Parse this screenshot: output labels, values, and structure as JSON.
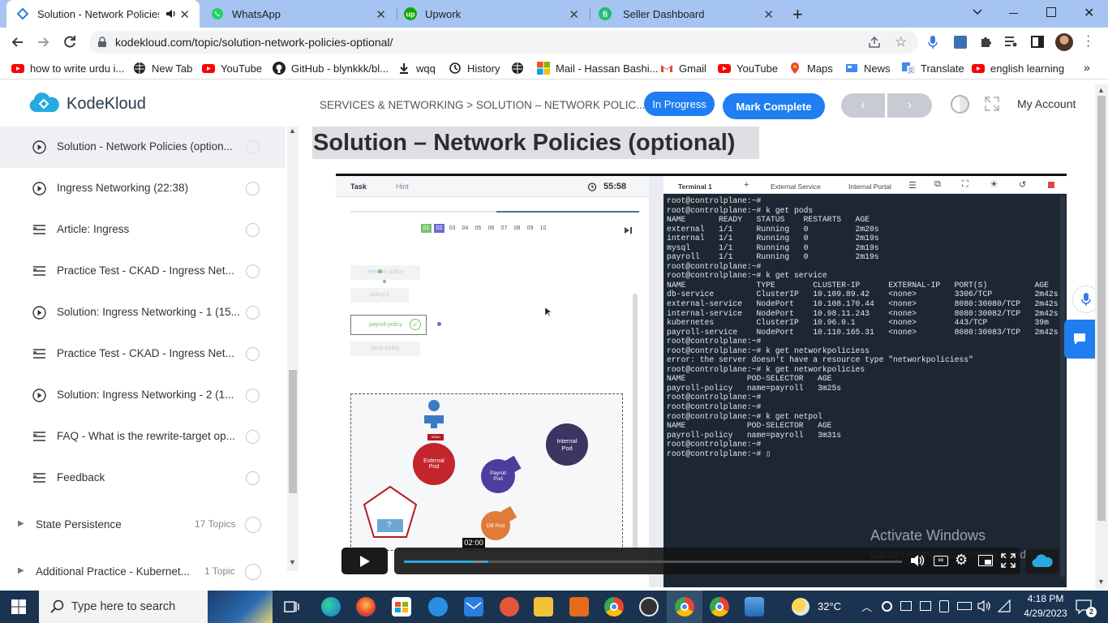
{
  "browser": {
    "tabs": [
      {
        "title": "Solution - Network Policies (o",
        "active": true,
        "audio": true
      },
      {
        "title": "WhatsApp",
        "active": false
      },
      {
        "title": "Upwork",
        "active": false
      },
      {
        "title": "Seller Dashboard",
        "active": false
      }
    ],
    "url": "kodekloud.com/topic/solution-network-policies-optional/",
    "bookmarks": [
      {
        "label": "how to write urdu i...",
        "icon": "youtube-icon"
      },
      {
        "label": "New Tab",
        "icon": "globe-icon"
      },
      {
        "label": "YouTube",
        "icon": "youtube-icon"
      },
      {
        "label": "GitHub - blynkkk/bl...",
        "icon": "github-icon"
      },
      {
        "label": "wqq",
        "icon": "download-icon"
      },
      {
        "label": "History",
        "icon": "history-icon"
      },
      {
        "label": "",
        "icon": "globe-icon"
      },
      {
        "label": "Mail - Hassan Bashi...",
        "icon": "microsoft-icon"
      },
      {
        "label": "Gmail",
        "icon": "gmail-icon"
      },
      {
        "label": "YouTube",
        "icon": "youtube-icon"
      },
      {
        "label": "Maps",
        "icon": "maps-icon"
      },
      {
        "label": "News",
        "icon": "news-icon"
      },
      {
        "label": "Translate",
        "icon": "translate-icon"
      },
      {
        "label": "english learning",
        "icon": "youtube-icon"
      }
    ]
  },
  "header": {
    "logo": "KodeKloud",
    "breadcrumb": "SERVICES & NETWORKING > SOLUTION – NETWORK POLIC...",
    "status_button": "In Progress",
    "complete_button": "Mark Complete",
    "account": "My Account"
  },
  "sidebar": {
    "items": [
      {
        "label": "Solution - Network Policies (option...",
        "type": "video",
        "active": true
      },
      {
        "label": "Ingress Networking (22:38)",
        "type": "video"
      },
      {
        "label": "Article: Ingress",
        "type": "article"
      },
      {
        "label": "Practice Test - CKAD - Ingress Net...",
        "type": "article"
      },
      {
        "label": "Solution: Ingress Networking - 1 (15...",
        "type": "video"
      },
      {
        "label": "Practice Test - CKAD - Ingress Net...",
        "type": "article"
      },
      {
        "label": "Solution: Ingress Networking - 2 (1...",
        "type": "video"
      },
      {
        "label": "FAQ - What is the rewrite-target op...",
        "type": "article"
      },
      {
        "label": "Feedback",
        "type": "article"
      }
    ],
    "sections": [
      {
        "label": "State Persistence",
        "count": "17 Topics"
      },
      {
        "label": "Additional Practice - Kubernet...",
        "count": "1 Topic"
      }
    ]
  },
  "main": {
    "title": "Solution – Network Policies (optional)"
  },
  "video": {
    "task_tab": "Task",
    "hint_tab": "Hint",
    "timer": "55:58",
    "question_numbers": [
      "01",
      "02",
      "03",
      "04",
      "05",
      "06",
      "07",
      "08",
      "09",
      "10"
    ],
    "policy_labels": [
      "network-policy",
      "policy-1",
      "payroll-policy",
      "deny-policy"
    ],
    "pods": {
      "external": "External Pod",
      "internal": "Internal Pod",
      "payroll": "Payroll Pod",
      "db": "DB Pod",
      "port_tag": "30080",
      "unknown": "?"
    },
    "terminal_tabs": [
      "Terminal 1",
      "External Service",
      "Internal Portal"
    ],
    "terminal_lines": [
      "root@controlplane:~#",
      "root@controlplane:~# k get pods",
      "NAME       READY   STATUS    RESTARTS   AGE",
      "external   1/1     Running   0          2m20s",
      "internal   1/1     Running   0          2m19s",
      "mysql      1/1     Running   0          2m19s",
      "payroll    1/1     Running   0          2m19s",
      "root@controlplane:~#",
      "root@controlplane:~# k get service",
      "NAME               TYPE        CLUSTER-IP      EXTERNAL-IP   PORT(S)          AGE",
      "db-service         ClusterIP   10.109.89.42    <none>        3306/TCP         2m42s",
      "external-service   NodePort    10.108.170.44   <none>        8080:30080/TCP   2m42s",
      "internal-service   NodePort    10.98.11.243    <none>        8080:30082/TCP   2m42s",
      "kubernetes         ClusterIP   10.96.0.1       <none>        443/TCP          39m",
      "payroll-service    NodePort    10.110.165.31   <none>        8080:30083/TCP   2m42s",
      "root@controlplane:~#",
      "root@controlplane:~# k get networkpoliciess",
      "error: the server doesn't have a resource type \"networkpoliciess\"",
      "root@controlplane:~# k get networkpolicies",
      "NAME             POD-SELECTOR   AGE",
      "payroll-policy   name=payroll   3m25s",
      "root@controlplane:~#",
      "root@controlplane:~#",
      "root@controlplane:~# k get netpol",
      "NAME             POD-SELECTOR   AGE",
      "payroll-policy   name=payroll   3m31s",
      "root@controlplane:~#",
      "root@controlplane:~# ▯"
    ],
    "current_time": "02:00",
    "progress": 0.17,
    "watermark_title": "Activate Windows",
    "watermark_sub": "Go to Settings to activate Windows."
  },
  "taskbar": {
    "search_placeholder": "Type here to search",
    "weather": "32°C",
    "time": "4:18 PM",
    "date": "4/29/2023",
    "notifications": "2"
  }
}
